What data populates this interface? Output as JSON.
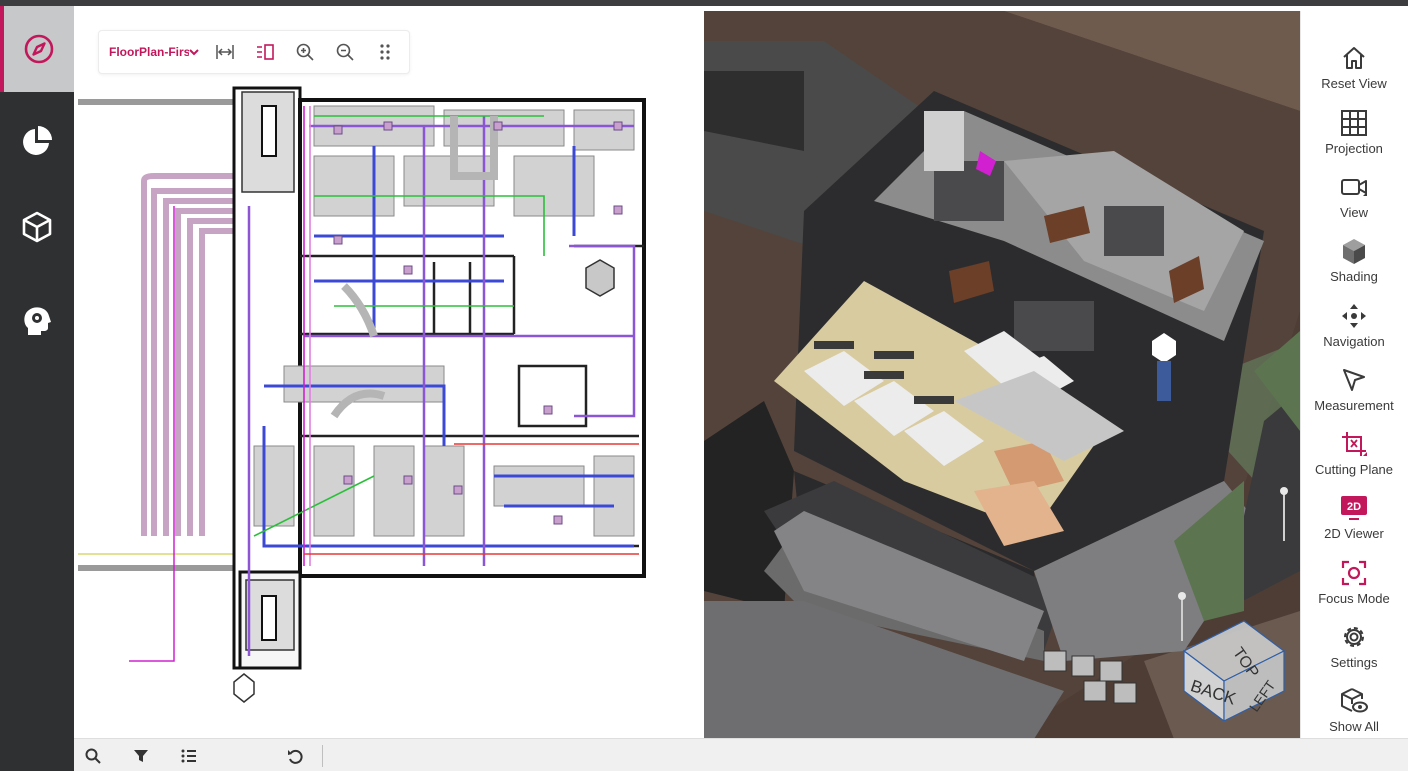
{
  "left_rail": {
    "items": [
      {
        "icon": "compass-icon",
        "active": true
      },
      {
        "icon": "pie-chart-icon",
        "active": false
      },
      {
        "icon": "cube-icon",
        "active": false
      },
      {
        "icon": "head-gear-icon",
        "active": false
      }
    ]
  },
  "viewer2d": {
    "plan_name": "FloorPlan-First",
    "toolbar_icons": [
      "fit-width-icon",
      "split-view-icon",
      "zoom-in-icon",
      "zoom-out-icon",
      "more-vertical-icon"
    ]
  },
  "viewer3d": {
    "viewcube": {
      "top_label": "TOP",
      "back_label": "BACK",
      "left_label": "LEFT"
    }
  },
  "right_toolbar": {
    "items": [
      {
        "label": "Reset View",
        "icon": "home-icon",
        "accent": false
      },
      {
        "label": "Projection",
        "icon": "grid-icon",
        "accent": false
      },
      {
        "label": "View",
        "icon": "video-camera-icon",
        "accent": false
      },
      {
        "label": "Shading",
        "icon": "shaded-cube-icon",
        "accent": false
      },
      {
        "label": "Navigation",
        "icon": "move-arrows-icon",
        "accent": false
      },
      {
        "label": "Measurement",
        "icon": "cursor-arrow-icon",
        "accent": false
      },
      {
        "label": "Cutting Plane",
        "icon": "crop-icon",
        "accent": true
      },
      {
        "label": "2D Viewer",
        "icon": "2d-badge-icon",
        "accent": true,
        "badge_text": "2D"
      },
      {
        "label": "Focus Mode",
        "icon": "focus-icon",
        "accent": true
      },
      {
        "label": "Settings",
        "icon": "gear-icon",
        "accent": false
      },
      {
        "label": "Show All",
        "icon": "cube-eye-icon",
        "accent": false
      }
    ]
  },
  "bottom_bar": {
    "icons": [
      "search-icon",
      "filter-icon",
      "list-icon",
      "undo-icon"
    ]
  },
  "colors": {
    "accent": "#c2185b",
    "rail_bg": "#2f3032",
    "rail_active_bg": "#c7c8ca",
    "icon_dark": "#3a3a3a"
  }
}
